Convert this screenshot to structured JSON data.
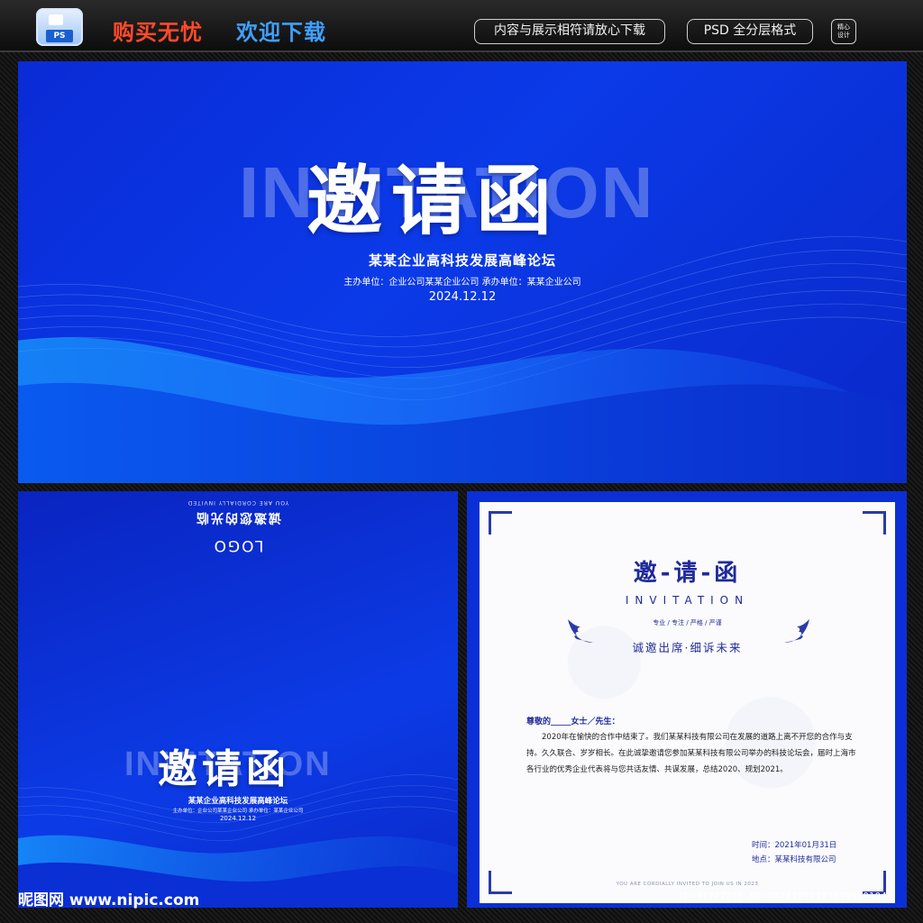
{
  "topbar": {
    "ps_tag": "PS",
    "slogan_buy": "购买无忧",
    "slogan_download": "欢迎下载",
    "pill_consistent": "内容与展示相符请放心下载",
    "pill_format": "PSD 全分层格式",
    "seal_line1": "精心",
    "seal_line2": "设计"
  },
  "banner": {
    "ghost_text": "INVITATION",
    "title": "邀请函",
    "subtitle": "某某企业高科技发展高峰论坛",
    "organizers": "主办单位：企业公司某某企业公司    承办单位：某某企业公司",
    "date": "2024.12.12"
  },
  "card_left": {
    "back_tagline": "YOU ARE CORDIALLY INVITED",
    "back_slogan": "诚邀您的光临",
    "back_logo": "LOGO",
    "ghost_text": "INVITATION",
    "title": "邀请函",
    "subtitle": "某某企业高科技发展高峰论坛",
    "organizers": "主办单位：企业公司某某企业公司    承办单位：某某企业公司",
    "date": "2024.12.12"
  },
  "card_right": {
    "title": "邀-请-函",
    "en_title": "INVITATION",
    "keywords": "专业 / 专注 / 严格 / 严谨",
    "slogan": "诚邀出席·细诉未来",
    "salutation": "尊敬的_____女士／先生：",
    "body": "2020年在愉快的合作中结束了。我们某某科技有限公司在发展的道路上离不开您的合作与支持。久久联合、岁岁相长。在此诚挚邀请您参加某某科技有限公司举办的科技论坛会，届时上海市各行业的优秀企业代表将与您共话友情、共谋发展，总结2020、规划2021。",
    "time_line": "时间：2021年01月31日",
    "place_line": "地点：某某科技有限公司",
    "footer_en": "YOU ARE CORDIALLY INVITED TO JOIN US IN 2023"
  },
  "footer": {
    "site_logo": "昵图网 www.nipic.com",
    "image_id": "ID:31727226 NO:20241212173539530104"
  },
  "colors": {
    "banner_blue": "#0b3ae8",
    "paper_accent": "#1f2a9a",
    "slogan_red": "#ff4a2a",
    "slogan_blue": "#3fa0ff"
  }
}
